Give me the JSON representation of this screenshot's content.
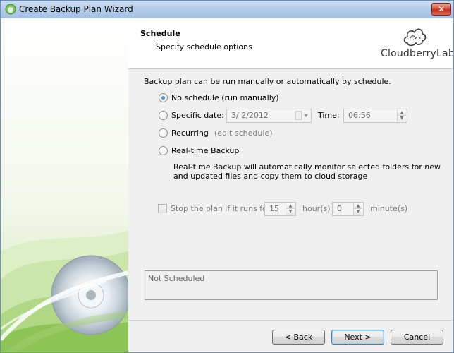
{
  "window": {
    "title": "Create Backup Plan Wizard",
    "close_label": "✕"
  },
  "header": {
    "title": "Schedule",
    "subtitle": "Specify schedule options",
    "brand": "CloudberryLab"
  },
  "schedule": {
    "intro": "Backup plan can be run manually or automatically by schedule.",
    "options": [
      {
        "label": "No schedule (run manually)",
        "selected": true
      },
      {
        "label": "Specific date:",
        "selected": false
      },
      {
        "label": "Recurring",
        "selected": false
      },
      {
        "label": "Real-time Backup",
        "selected": false
      }
    ],
    "date_value": "3/  2/2012",
    "time_label": "Time:",
    "time_value": "06:56",
    "edit_schedule_link": "(edit schedule)",
    "realtime_desc_line1": "Real-time Backup will automatically monitor selected folders for new",
    "realtime_desc_line2": "and updated files and copy them to cloud storage",
    "stop_label": "Stop the plan if it runs for:",
    "stop_checked": false,
    "hours_value": "15",
    "hours_label": "hour(s)",
    "minutes_value": "0",
    "minutes_label": "minute(s)"
  },
  "status": {
    "text": "Not Scheduled"
  },
  "footer": {
    "back_label": "< Back",
    "next_label": "Next >",
    "cancel_label": "Cancel"
  },
  "colors": {
    "title_bar": "#b4cce8",
    "close_button": "#c3311a",
    "banner_green": "#9bcb5a",
    "default_button_border": "#3c7fb1"
  }
}
